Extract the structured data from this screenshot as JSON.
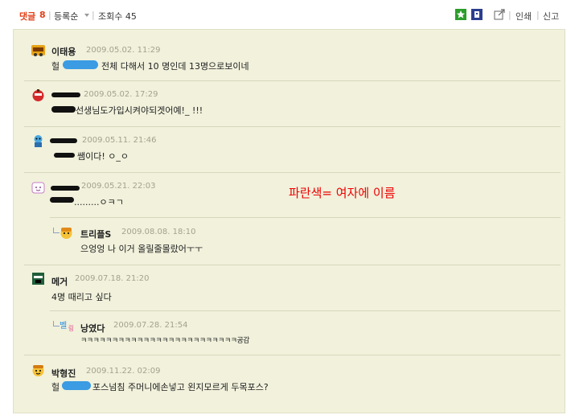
{
  "header": {
    "comments_label": "댓글",
    "comments_count": "8",
    "sort_label": "등록순",
    "views_label": "조회수 45",
    "print_label": "인쇄",
    "report_label": "신고"
  },
  "annotation": "파란색= 여자에 이름",
  "comments": [
    {
      "name": "이태용",
      "date": "2009.05.02. 11:29",
      "text_prefix": "헐",
      "text": "전체 다해서 10 명인데 13명으로보이네"
    },
    {
      "name": "",
      "date": "2009.05.02. 17:29",
      "text": "선생님도가입시켜야되겟어예!_ !!!"
    },
    {
      "name": "",
      "date": "2009.05.11. 21:46",
      "text": "쌤이다! ㅇ_ㅇ"
    },
    {
      "name": "",
      "date": "2009.05.21. 22:03",
      "text": ".........ㅇㅋㄱ"
    },
    {
      "name": "트리플S",
      "date": "2009.08.08. 18:10",
      "text": "으엉엉 나 이거 올릴줄몰랐어ㅜㅜ",
      "reply": true
    },
    {
      "name": "메거",
      "date": "2009.07.18. 21:20",
      "text": "4명 때리고 싶다"
    },
    {
      "name": "낭였다",
      "date": "2009.07.28. 21:54",
      "text": "ㅋㅋㅋㅋㅋㅋㅋㅋㅋㅋㅋㅋㅋㅋㅋㅋㅋㅋㅋㅋㅋㅋㅋㅋㅋ공감",
      "reply": true
    },
    {
      "name": "박형진",
      "date": "2009.11.22. 02:09",
      "text_prefix": "헐",
      "text": "포스넘침 주머니에손넣고 왼지모르게 두목포스?"
    }
  ],
  "colors": {
    "panel_bg": "#f1f1dc",
    "comment_count": "#e2421a",
    "annotation": "#ee0000",
    "name_highlight": "#3b9be3"
  }
}
